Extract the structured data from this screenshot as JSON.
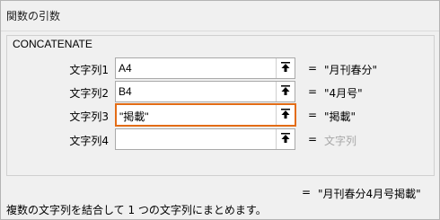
{
  "dialog": {
    "title": "関数の引数",
    "function_name": "CONCATENATE",
    "args": [
      {
        "label": "文字列1",
        "value": "A4",
        "result": "\"月刊春分\""
      },
      {
        "label": "文字列2",
        "value": "B4",
        "result": "\"4月号\""
      },
      {
        "label": "文字列3",
        "value": "\"掲載\"",
        "result": "\"掲載\""
      },
      {
        "label": "文字列4",
        "value": "",
        "result": "文字列"
      }
    ],
    "equals": "=",
    "formula_result": "\"月刊春分4月号掲載\"",
    "description": "複数の文字列を結合して 1 つの文字列にまとめます。"
  },
  "colors": {
    "active_border": "#e36c16",
    "placeholder": "#a8a8a8"
  },
  "icons": {
    "collapse": "collapse-dialog-icon"
  }
}
